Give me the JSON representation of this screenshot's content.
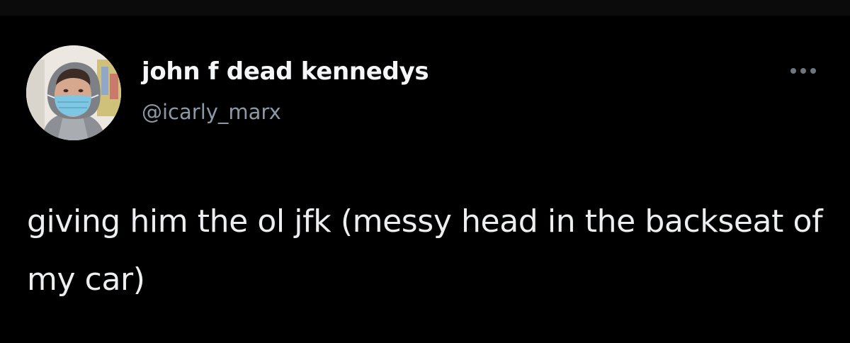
{
  "tweet": {
    "display_name": "john f dead kennedys",
    "handle": "@icarly_marx",
    "text": "giving him the ol jfk (messy head in the backseat of my car)"
  },
  "icons": {
    "avatar": "profile-photo",
    "more": "more-options-icon"
  },
  "colors": {
    "background": "#000000",
    "display_name": "#f5f6f7",
    "handle": "#8b98a5",
    "text": "#eceef0",
    "more_dots": "#6e767d"
  }
}
